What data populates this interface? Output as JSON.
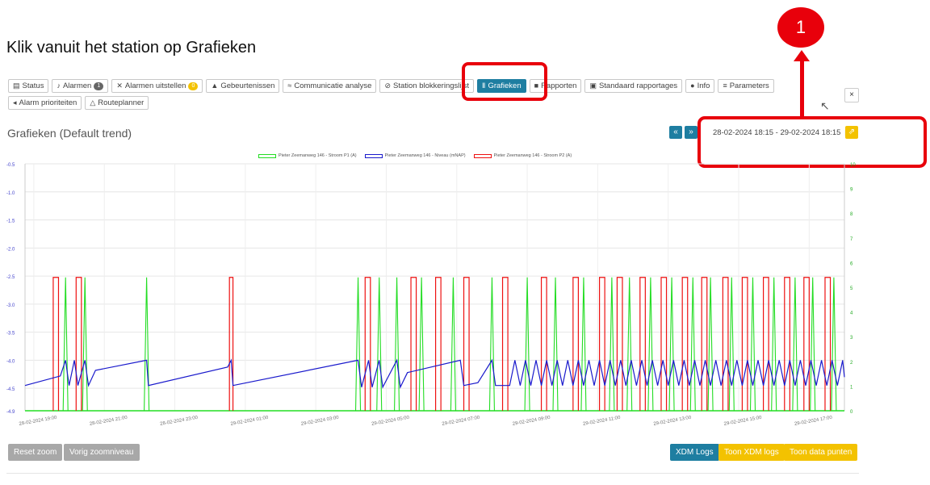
{
  "heading": "Klik vanuit het station op Grafieken",
  "marker": "1",
  "toolbar_row1": [
    {
      "icon": "▤",
      "label": "Status",
      "name": "tab-status"
    },
    {
      "icon": "♪",
      "label": "Alarmen",
      "badge": "1",
      "badge_color": "#666666",
      "name": "tab-alarmen"
    },
    {
      "icon": "✕",
      "label": "Alarmen uitstellen",
      "badge": "0",
      "badge_color": "#f3c200",
      "name": "tab-alarmen-uitstellen"
    },
    {
      "icon": "▲",
      "label": "Gebeurtenissen",
      "name": "tab-gebeurtenissen"
    },
    {
      "icon": "≈",
      "label": "Communicatie analyse",
      "name": "tab-communicatie-analyse"
    },
    {
      "icon": "⊘",
      "label": "Station blokkeringslijst",
      "name": "tab-station-blokkeringslijst"
    },
    {
      "icon": "Ⅱ",
      "label": "Grafieken",
      "active": true,
      "name": "tab-grafieken"
    },
    {
      "icon": "■",
      "label": "Rapporten",
      "name": "tab-rapporten"
    },
    {
      "icon": "▣",
      "label": "Standaard rapportages",
      "name": "tab-standaard-rapportages"
    },
    {
      "icon": "●",
      "label": "Info",
      "name": "tab-info"
    },
    {
      "icon": "≡",
      "label": "Parameters",
      "name": "tab-parameters"
    }
  ],
  "toolbar_row2": [
    {
      "icon": "◂",
      "label": "Alarm prioriteiten",
      "name": "tab-alarm-prioriteiten"
    },
    {
      "icon": "△",
      "label": "Routeplanner",
      "name": "tab-routeplanner"
    }
  ],
  "close_label": "×",
  "subtitle": "Grafieken (Default trend)",
  "nav_prev": "«",
  "nav_next": "»",
  "date_range": "28-02-2024 18:15 - 29-02-2024 18:15",
  "buttons": {
    "reset_zoom": "Reset zoom",
    "prev_zoom": "Vorig zoomniveau",
    "xdm_logs": "XDM Logs",
    "toon_xdm_logs": "Toon XDM logs",
    "toon_data_punten": "Toon data punten"
  },
  "chart_data": {
    "type": "line",
    "legend": [
      "Pieter Zeemanweg 146 - Stroom P1 (A)",
      "Pieter Zeemanweg 146 - Niveau (mNAP)",
      "Pieter Zeemanweg 146 - Stroom P2 (A)"
    ],
    "legend_position": "top-center",
    "colors": {
      "p1": "#22dd22",
      "niveau": "#1a1acc",
      "p2": "#ee1111"
    },
    "y_left": {
      "ticks": [
        "-0.5",
        "-1.0",
        "-1.5",
        "-2.0",
        "-2.5",
        "-3.0",
        "-3.5",
        "-4.0",
        "-4.5",
        "-4.9"
      ],
      "range": [
        -4.9,
        -0.5
      ]
    },
    "y_right": {
      "ticks": [
        "10",
        "9",
        "8",
        "7",
        "6",
        "5",
        "4",
        "3",
        "2",
        "1",
        "0"
      ],
      "range": [
        0,
        10
      ]
    },
    "x_ticks": [
      "28-02-2024 19:00",
      "28-02-2024 21:00",
      "28-02-2024 23:00",
      "29-02-2024 01:00",
      "29-02-2024 03:00",
      "29-02-2024 05:00",
      "29-02-2024 07:00",
      "29-02-2024 09:00",
      "29-02-2024 11:00",
      "29-02-2024 13:00",
      "29-02-2024 15:00",
      "29-02-2024 17:00"
    ],
    "p2_pulses_hours": [
      [
        1.55,
        1.7
      ],
      [
        2.2,
        2.35
      ],
      [
        6.55,
        6.65
      ],
      [
        10.4,
        10.55
      ],
      [
        11.7,
        11.85
      ],
      [
        12.4,
        12.55
      ],
      [
        13.2,
        13.35
      ],
      [
        14.3,
        14.45
      ],
      [
        15.4,
        15.55
      ],
      [
        16.3,
        16.45
      ],
      [
        17.05,
        17.2
      ],
      [
        17.55,
        17.7
      ],
      [
        18.2,
        18.35
      ],
      [
        18.8,
        18.95
      ],
      [
        19.4,
        19.55
      ],
      [
        19.95,
        20.1
      ],
      [
        20.55,
        20.7
      ],
      [
        21.1,
        21.25
      ],
      [
        21.7,
        21.85
      ],
      [
        22.3,
        22.45
      ],
      [
        22.85,
        23.0
      ],
      [
        23.45,
        23.6
      ]
    ],
    "p1_spikes_hours": [
      1.9,
      2.45,
      4.2,
      10.2,
      10.8,
      11.3,
      12.0,
      12.9,
      14.0,
      15.0,
      15.8,
      16.6,
      17.4,
      17.9,
      18.5,
      19.1,
      19.7,
      20.2,
      20.8,
      21.4,
      22.0,
      22.6,
      23.1,
      23.7
    ],
    "p2_level": 5.4,
    "p1_level": 5.4
  }
}
